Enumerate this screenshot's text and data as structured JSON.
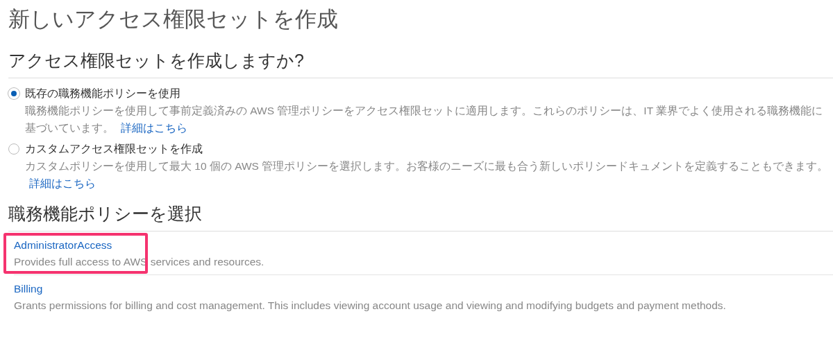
{
  "title": "新しいアクセス権限セットを作成",
  "question": "アクセス権限セットを作成しますか?",
  "options": [
    {
      "label": "既存の職務機能ポリシーを使用",
      "description": "職務機能ポリシーを使用して事前定義済みの AWS 管理ポリシーをアクセス権限セットに適用します。これらのポリシーは、IT 業界でよく使用される職務機能に基づいています。",
      "link": "詳細はこちら",
      "selected": true
    },
    {
      "label": "カスタムアクセス権限セットを作成",
      "description": "カスタムポリシーを使用して最大 10 個の AWS 管理ポリシーを選択します。お客様のニーズに最も合う新しいポリシードキュメントを定義することもできます。",
      "link": "詳細はこちら",
      "selected": false
    }
  ],
  "policy_heading": "職務機能ポリシーを選択",
  "policies": [
    {
      "name": "AdministratorAccess",
      "description": "Provides full access to AWS services and resources.",
      "highlighted": true
    },
    {
      "name": "Billing",
      "description": "Grants permissions for billing and cost management. This includes viewing account usage and viewing and modifying budgets and payment methods.",
      "highlighted": false
    }
  ]
}
